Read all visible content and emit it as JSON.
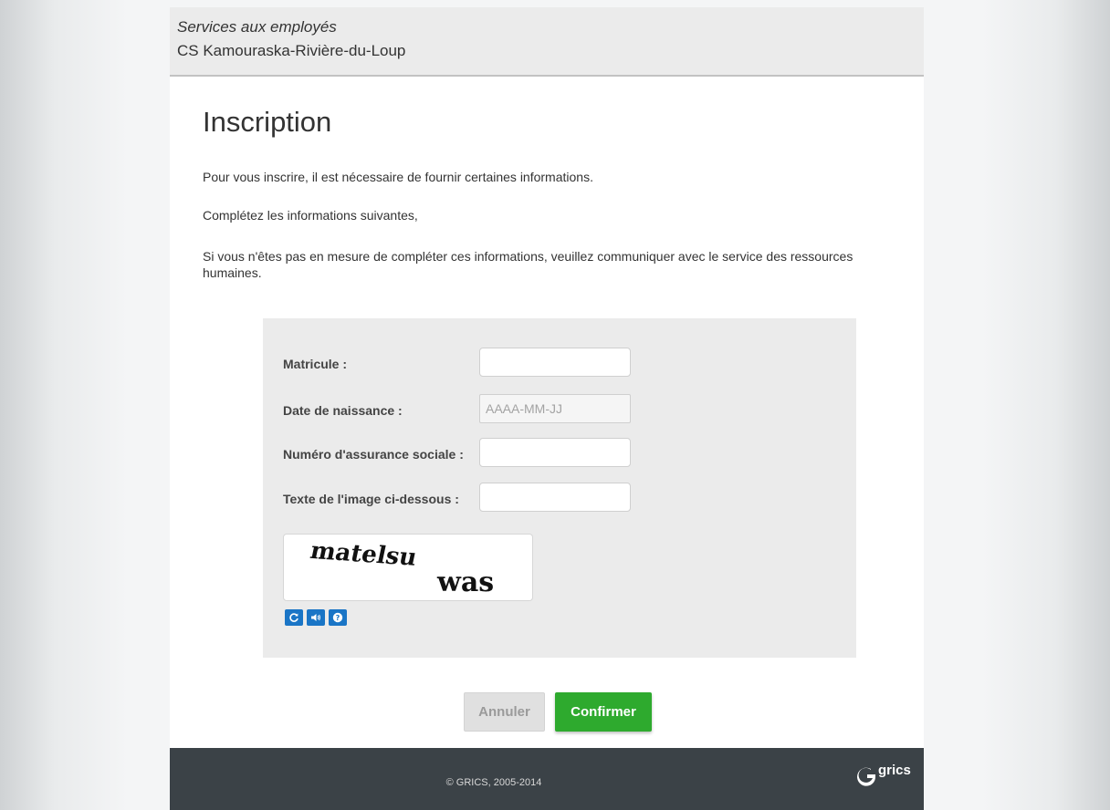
{
  "header": {
    "subtitle": "Services aux employés",
    "title": "CS Kamouraska-Rivière-du-Loup"
  },
  "main": {
    "title": "Inscription",
    "intro": "Pour vous inscrire, il est nécessaire de fournir certaines informations.",
    "instruction": "Complétez les informations suivantes,",
    "help": "Si vous n'êtes pas en mesure de compléter ces informations, veuillez communiquer avec le service des ressources humaines."
  },
  "form": {
    "matricule_label": "Matricule :",
    "matricule_value": "",
    "birthdate_label": "Date de naissance :",
    "birthdate_placeholder": "AAAA-MM-JJ",
    "birthdate_value": "",
    "nas_label": "Numéro d'assurance sociale :",
    "nas_value": "",
    "captcha_label": "Texte de l'image ci-dessous :",
    "captcha_value": "",
    "captcha_image": {
      "word1": "matelsu",
      "word2": "was"
    },
    "captcha_icons": [
      "refresh-icon",
      "audio-icon",
      "help-icon"
    ]
  },
  "buttons": {
    "cancel_label": "Annuler",
    "confirm_label": "Confirmer"
  },
  "footer": {
    "copyright": "© GRICS, 2005-2014",
    "logo_text": "grics"
  },
  "colors": {
    "confirm": "#2eaa2e",
    "footer_bg": "#3b4247",
    "captcha_icon": "#1a75c6"
  }
}
